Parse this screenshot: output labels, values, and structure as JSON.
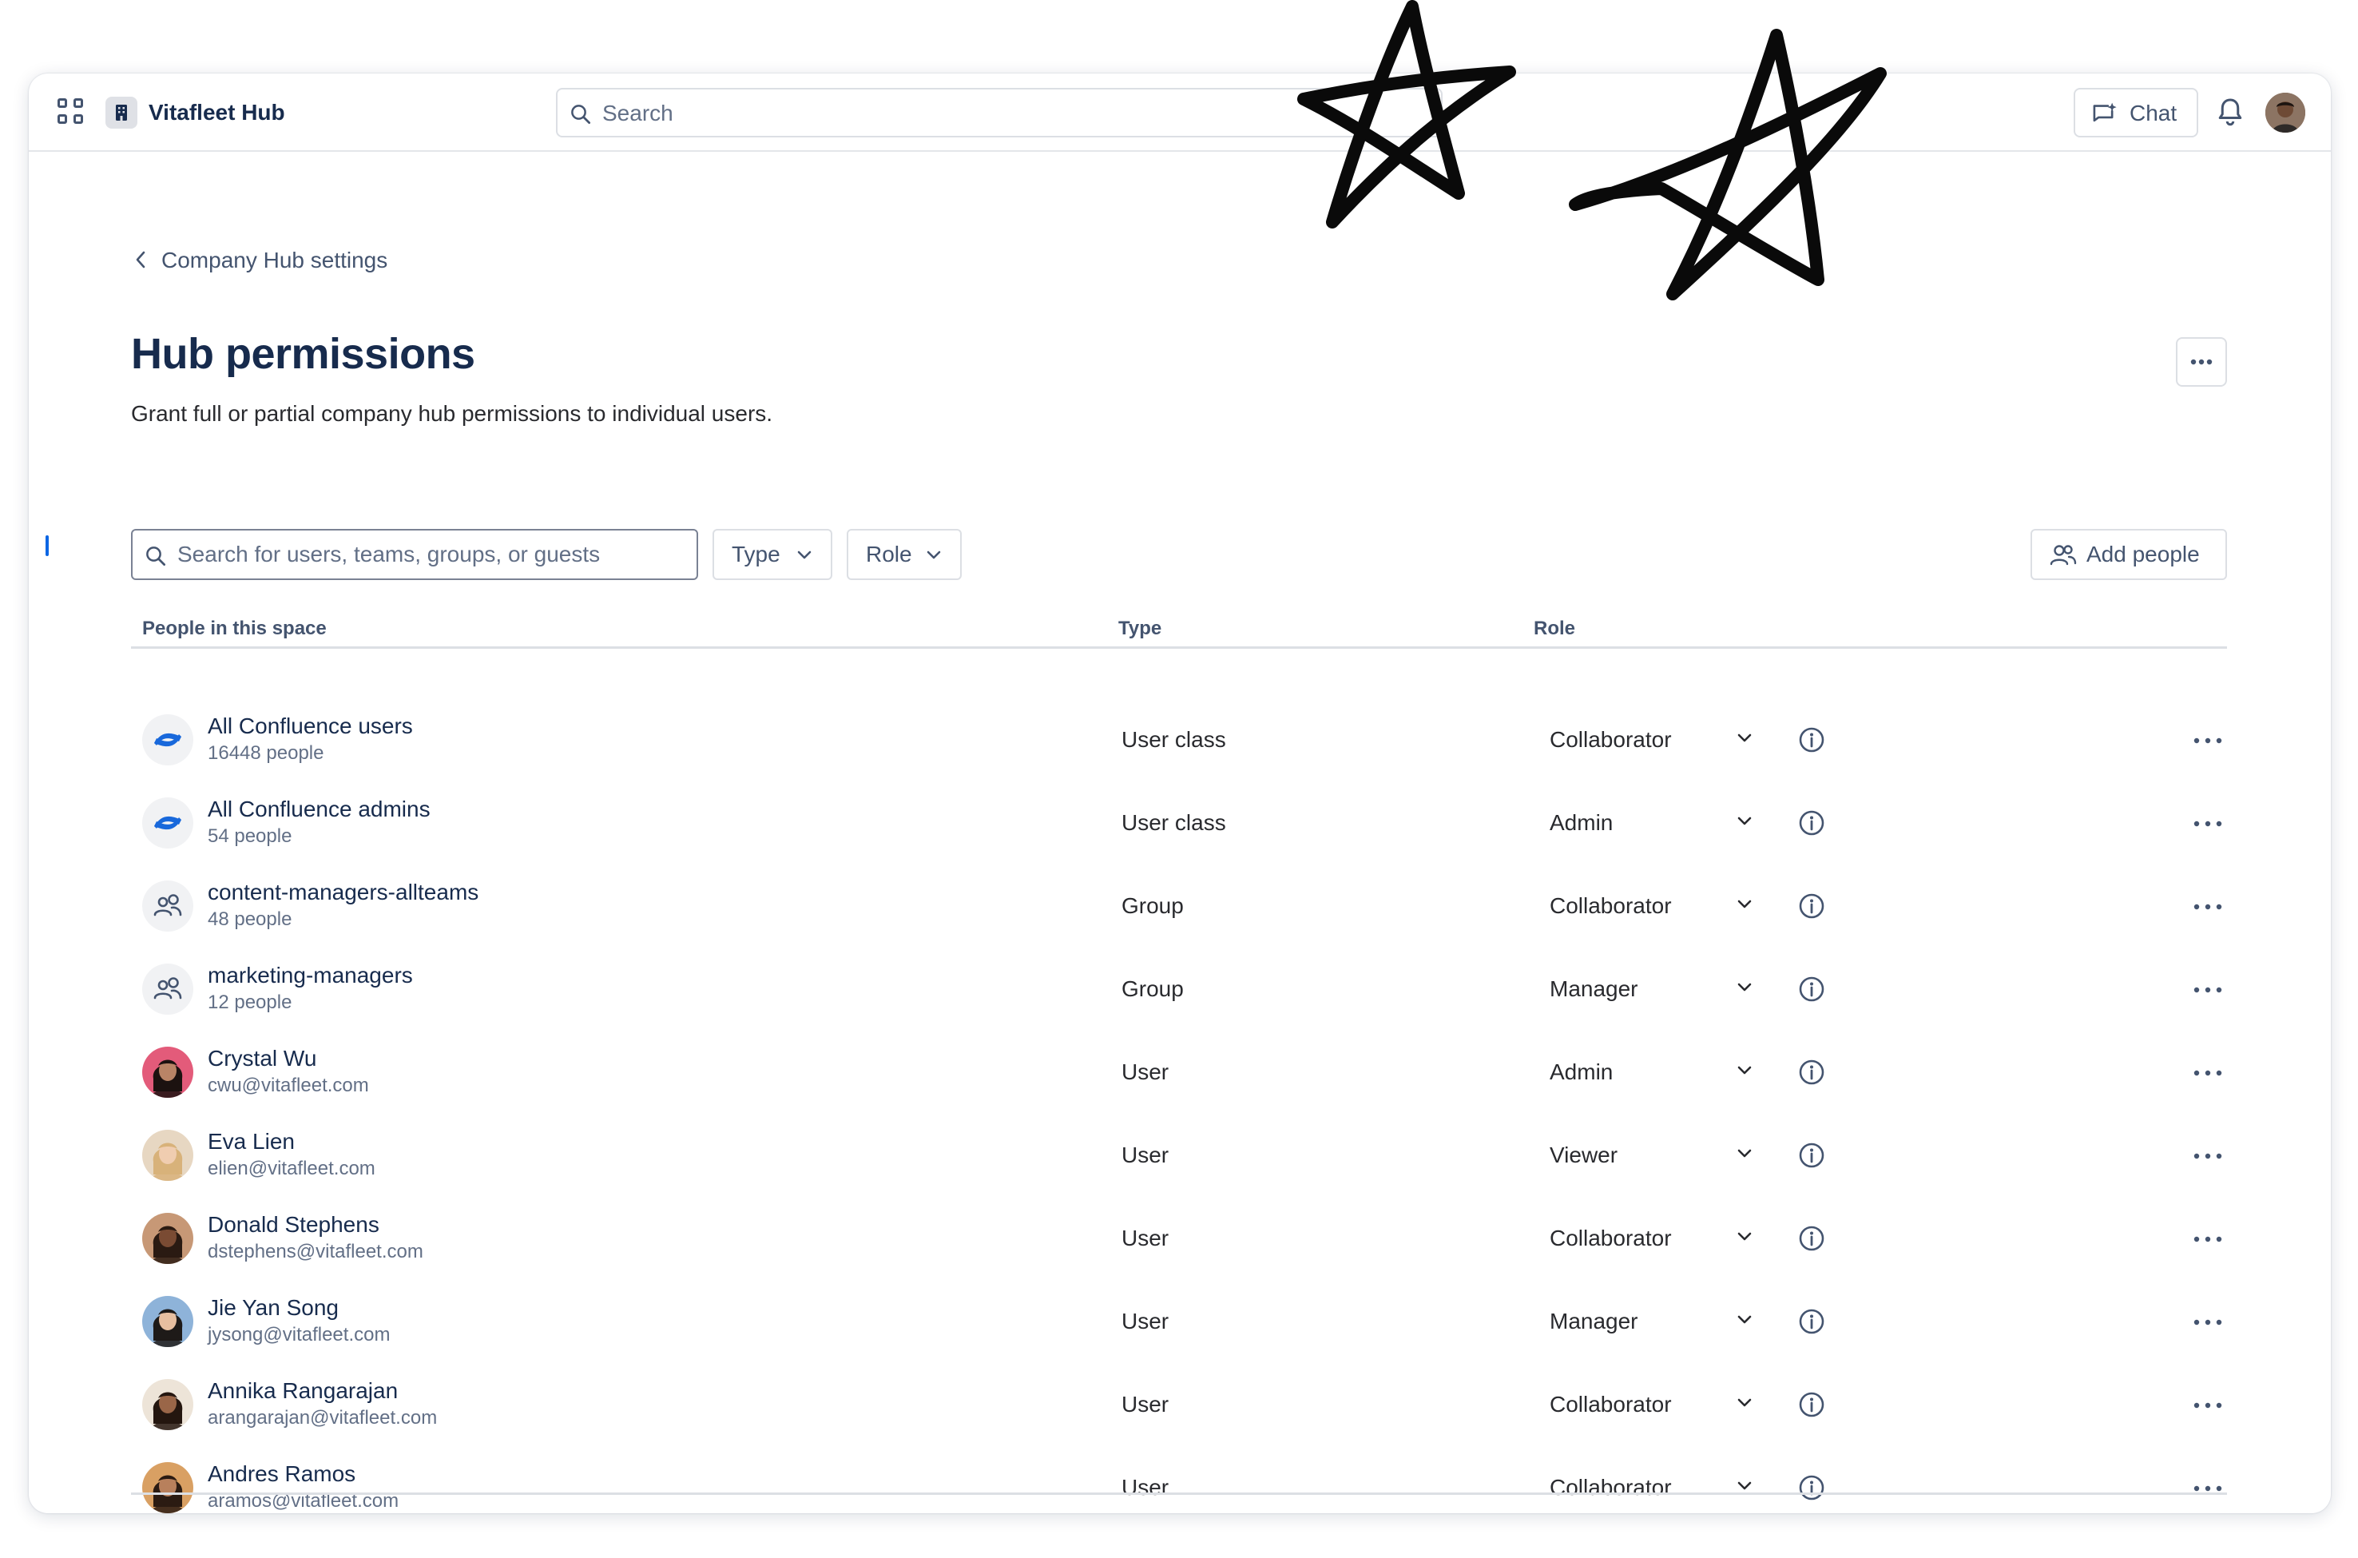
{
  "app": {
    "name": "Vitafleet Hub"
  },
  "topbar": {
    "search_placeholder": "Search",
    "chat_label": "Chat"
  },
  "breadcrumb": {
    "label": "Company Hub settings"
  },
  "page": {
    "title": "Hub permissions",
    "description": "Grant full or partial company hub permissions to individual users."
  },
  "filters": {
    "search_placeholder": "Search for users, teams, groups, or guests",
    "type_label": "Type",
    "role_label": "Role",
    "add_people_label": "Add people"
  },
  "table": {
    "headers": {
      "people": "People in this space",
      "type": "Type",
      "role": "Role"
    },
    "rows": [
      {
        "name": "All Confluence users",
        "sub": "16448 people",
        "type": "User class",
        "role": "Collaborator",
        "avatar": "confluence-icon"
      },
      {
        "name": "All Confluence admins",
        "sub": "54 people",
        "type": "User class",
        "role": "Admin",
        "avatar": "confluence-icon"
      },
      {
        "name": "content-managers-allteams",
        "sub": "48 people",
        "type": "Group",
        "role": "Collaborator",
        "avatar": "group-icon"
      },
      {
        "name": "marketing-managers",
        "sub": "12 people",
        "type": "Group",
        "role": "Manager",
        "avatar": "group-icon"
      },
      {
        "name": "Crystal Wu",
        "sub": "cwu@vitafleet.com",
        "type": "User",
        "role": "Admin",
        "avatar": "photo",
        "skin": "#B98466",
        "hair": "#1C1210",
        "bg": "#E35B7A"
      },
      {
        "name": "Eva Lien",
        "sub": "elien@vitafleet.com",
        "type": "User",
        "role": "Viewer",
        "avatar": "photo",
        "skin": "#F0CDB0",
        "hair": "#D8B27A",
        "bg": "#E7D7C2"
      },
      {
        "name": "Donald Stephens",
        "sub": "dstephens@vitafleet.com",
        "type": "User",
        "role": "Collaborator",
        "avatar": "photo",
        "skin": "#7A4B33",
        "hair": "#2A1A12",
        "bg": "#C79876"
      },
      {
        "name": "Jie Yan Song",
        "sub": "jysong@vitafleet.com",
        "type": "User",
        "role": "Manager",
        "avatar": "photo",
        "skin": "#E7BFA0",
        "hair": "#1E1A18",
        "bg": "#8EB3D9"
      },
      {
        "name": "Annika Rangarajan",
        "sub": "arangarajan@vitafleet.com",
        "type": "User",
        "role": "Collaborator",
        "avatar": "photo",
        "skin": "#9A6648",
        "hair": "#24160F",
        "bg": "#EDE4D8"
      },
      {
        "name": "Andres Ramos",
        "sub": "aramos@vitafleet.com",
        "type": "User",
        "role": "Collaborator",
        "avatar": "photo",
        "skin": "#B8805C",
        "hair": "#2B1B12",
        "bg": "#D9A063"
      }
    ]
  },
  "colors": {
    "accent": "#0C66E4",
    "text": "#172B4D",
    "subtle": "#626F86",
    "border": "#DCDFE4"
  }
}
